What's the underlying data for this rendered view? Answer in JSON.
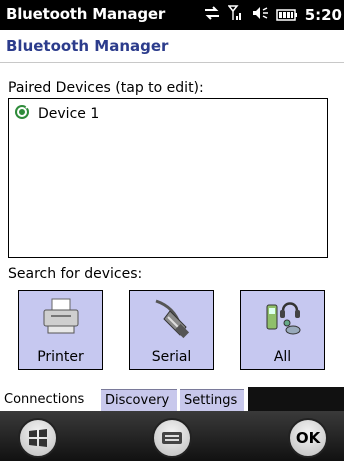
{
  "titlebar": {
    "app_title": "Bluetooth Manager",
    "clock": "5:20"
  },
  "header": {
    "page_title": "Bluetooth Manager"
  },
  "paired": {
    "label": "Paired Devices (tap to edit):",
    "devices": [
      {
        "name": "Device 1",
        "icon": "bluetooth-device-icon"
      }
    ]
  },
  "search": {
    "label": "Search for devices:",
    "buttons": [
      {
        "label": "Printer",
        "icon": "printer-icon"
      },
      {
        "label": "Serial",
        "icon": "serial-cable-icon"
      },
      {
        "label": "All",
        "icon": "all-devices-icon"
      }
    ]
  },
  "tabs": [
    {
      "label": "Connections",
      "active": true
    },
    {
      "label": "Discovery",
      "active": false
    },
    {
      "label": "Settings",
      "active": false
    }
  ],
  "softkeys": {
    "ok_label": "OK"
  },
  "colors": {
    "accent": "#2c3c8c",
    "tile": "#c6c8f0",
    "titlebar": "#000000"
  }
}
